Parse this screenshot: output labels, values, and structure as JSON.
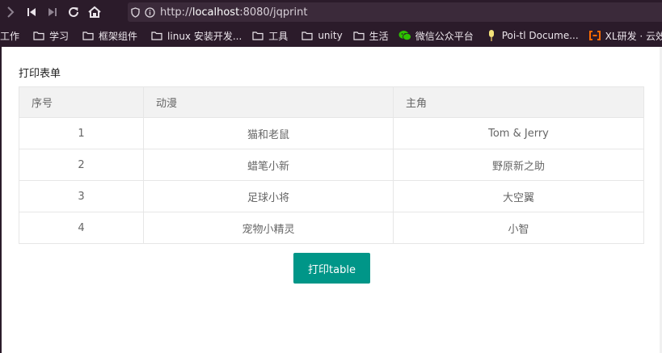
{
  "browser": {
    "url_prefix": "http://",
    "url_host": "localhost",
    "url_rest": ":8080/jqprint"
  },
  "bookmarks": [
    {
      "label": "工作",
      "icon": "none"
    },
    {
      "label": "学习",
      "icon": "folder-icon"
    },
    {
      "label": "框架组件",
      "icon": "folder-icon"
    },
    {
      "label": "linux 安装开发...",
      "icon": "folder-icon"
    },
    {
      "label": "工具",
      "icon": "folder-icon"
    },
    {
      "label": "unity",
      "icon": "folder-icon"
    },
    {
      "label": "生活",
      "icon": "folder-icon"
    },
    {
      "label": "微信公众平台",
      "icon": "wechat-icon"
    },
    {
      "label": "Poi-tl Docume...",
      "icon": "popsicle-icon"
    },
    {
      "label": "XL研发 · 云效",
      "icon": "aliyun-icon"
    }
  ],
  "page": {
    "title": "打印表单",
    "table": {
      "headers": [
        "序号",
        "动漫",
        "主角"
      ],
      "rows": [
        [
          "1",
          "猫和老鼠",
          "Tom & Jerry"
        ],
        [
          "2",
          "蜡笔小新",
          "野原新之助"
        ],
        [
          "3",
          "足球小将",
          "大空翼"
        ],
        [
          "4",
          "宠物小精灵",
          "小智"
        ]
      ]
    },
    "print_button": "打印table"
  },
  "colors": {
    "chrome_bg": "#2b1b2a",
    "button_bg": "#009688",
    "header_bg": "#f2f2f2",
    "border": "#e6e6e6"
  }
}
